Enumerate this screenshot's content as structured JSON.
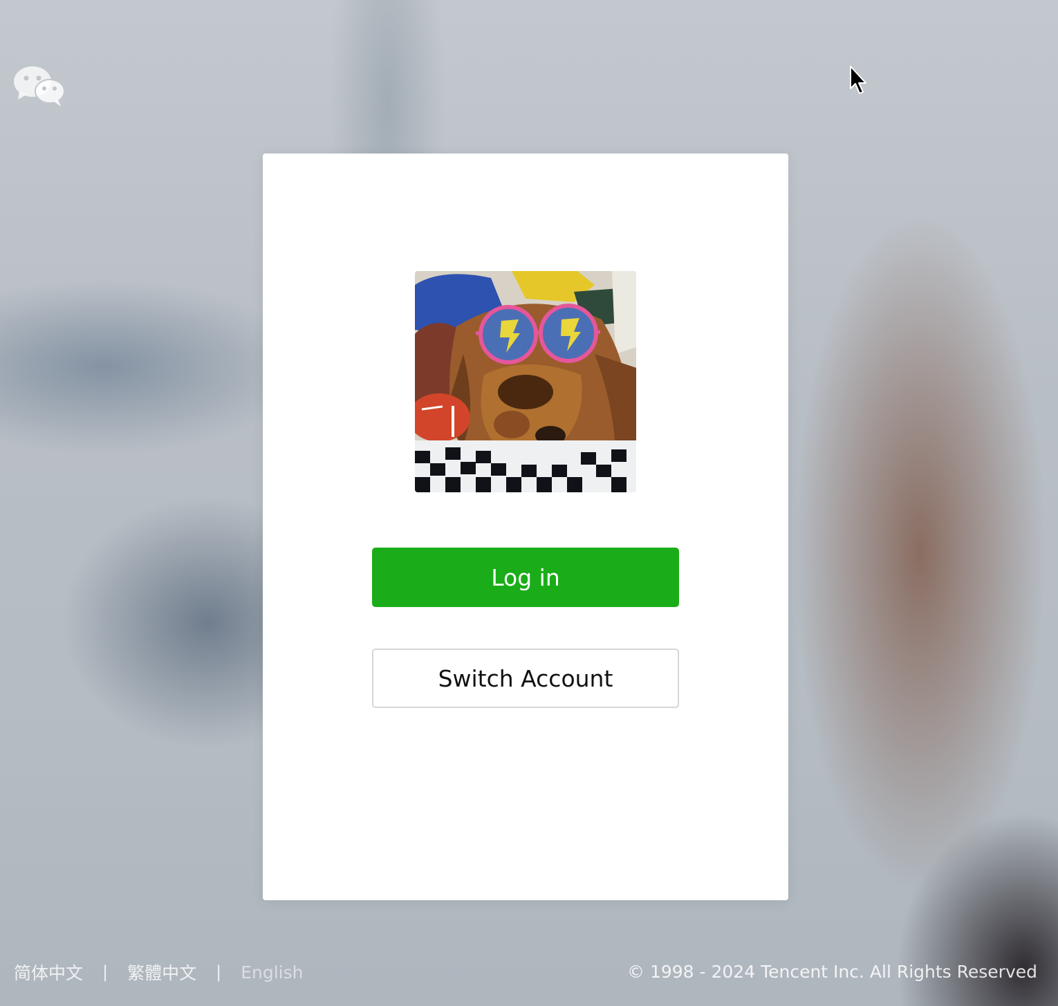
{
  "app": {
    "title": "WeChat"
  },
  "header": {
    "logo_icon": "wechat-logo-icon"
  },
  "login_card": {
    "avatar_icon": "user-avatar-dog",
    "login_label": "Log in",
    "switch_label": "Switch Account",
    "login_color": "#1aad19"
  },
  "footer": {
    "languages": [
      "简体中文",
      "繁體中文",
      "English"
    ],
    "separator": "|",
    "copyright": "© 1998 - 2024 Tencent Inc. All Rights Reserved"
  }
}
